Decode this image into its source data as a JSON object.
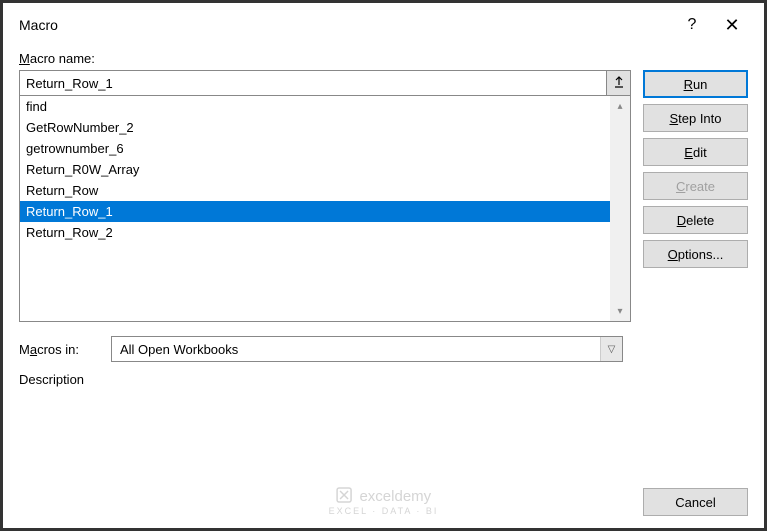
{
  "titlebar": {
    "title": "Macro",
    "help_label": "?",
    "close_label": "✕"
  },
  "labels": {
    "macro_name_prefix": "M",
    "macro_name_rest": "acro name:",
    "macros_in_prefix": "M",
    "macros_in_underline": "a",
    "macros_in_rest": "cros in:",
    "description": "Description"
  },
  "input": {
    "value": "Return_Row_1"
  },
  "macro_list": [
    "find",
    "GetRowNumber_2",
    "getrownumber_6",
    "Return_R0W_Array",
    "Return_Row",
    "Return_Row_1",
    "Return_Row_2"
  ],
  "selected_index": 5,
  "buttons": {
    "run_underline": "R",
    "run_rest": "un",
    "stepinto_underline": "S",
    "stepinto_rest": "tep Into",
    "edit_underline": "E",
    "edit_rest": "dit",
    "create_underline": "C",
    "create_rest": "reate",
    "delete_underline": "D",
    "delete_rest": "elete",
    "options_underline": "O",
    "options_rest": "ptions...",
    "cancel": "Cancel"
  },
  "dropdown": {
    "value": "All Open Workbooks"
  },
  "watermark": {
    "name": "exceldemy",
    "sub": "EXCEL · DATA · BI"
  }
}
